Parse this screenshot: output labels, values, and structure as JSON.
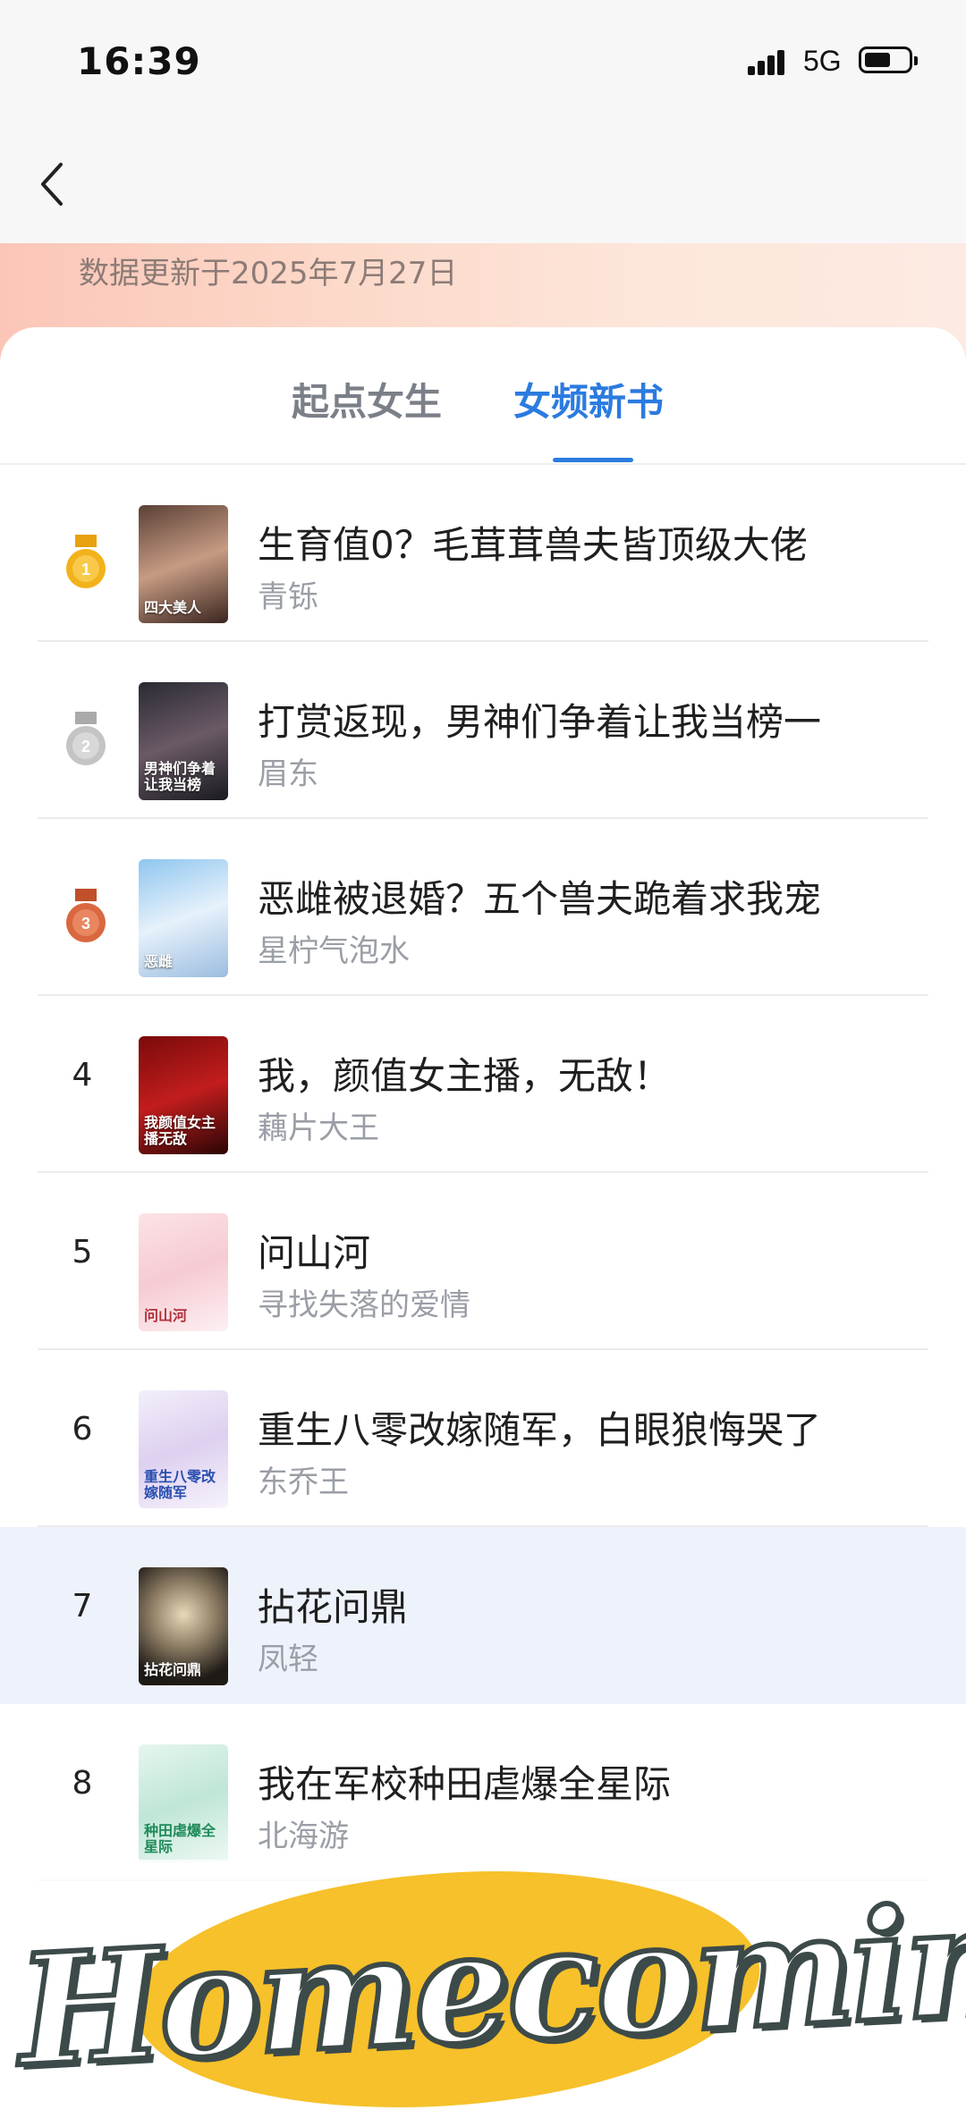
{
  "status_bar": {
    "time": "16:39",
    "network": "5G",
    "signal_icon": "cellular-signal-icon",
    "battery_icon": "battery-icon"
  },
  "nav": {
    "back_icon": "chevron-left-icon"
  },
  "header": {
    "update_text": "数据更新于2025年7月27日"
  },
  "tabs": [
    {
      "label": "起点女生",
      "active": false
    },
    {
      "label": "女频新书",
      "active": true
    }
  ],
  "colors": {
    "accent": "#2b7be0",
    "gold": "#f2b21b",
    "silver": "#c4c4c4",
    "bronze": "#d9673f"
  },
  "books": [
    {
      "rank": "1",
      "medal": "gold-medal-icon",
      "title": "生育值0？毛茸茸兽夫皆顶级大佬",
      "author": "青铄"
    },
    {
      "rank": "2",
      "medal": "silver-medal-icon",
      "title": "打赏返现，男神们争着让我当榜一",
      "author": "眉东"
    },
    {
      "rank": "3",
      "medal": "bronze-medal-icon",
      "title": "恶雌被退婚？五个兽夫跪着求我宠",
      "author": "星柠气泡水"
    },
    {
      "rank": "4",
      "title": "我，颜值女主播，无敌！",
      "author": "藕片大王"
    },
    {
      "rank": "5",
      "title": "问山河",
      "author": "寻找失落的爱情"
    },
    {
      "rank": "6",
      "title": "重生八零改嫁随军，白眼狼悔哭了",
      "author": "东乔王"
    },
    {
      "rank": "7",
      "title": "拈花问鼎",
      "author": "凤轻"
    },
    {
      "rank": "8",
      "title": "我在军校种田虐爆全星际",
      "author": "北海游"
    }
  ],
  "covers": [
    {
      "text": "四大美人"
    },
    {
      "text": "男神们争着让我当榜"
    },
    {
      "text": "恶雌"
    },
    {
      "text": "我颜值女主播无敌"
    },
    {
      "text": "问山河"
    },
    {
      "text": "重生八零改嫁随军"
    },
    {
      "text": "拈花问鼎"
    },
    {
      "text": "种田虐爆全星际"
    }
  ],
  "sticker": {
    "text": "Homecoming"
  }
}
